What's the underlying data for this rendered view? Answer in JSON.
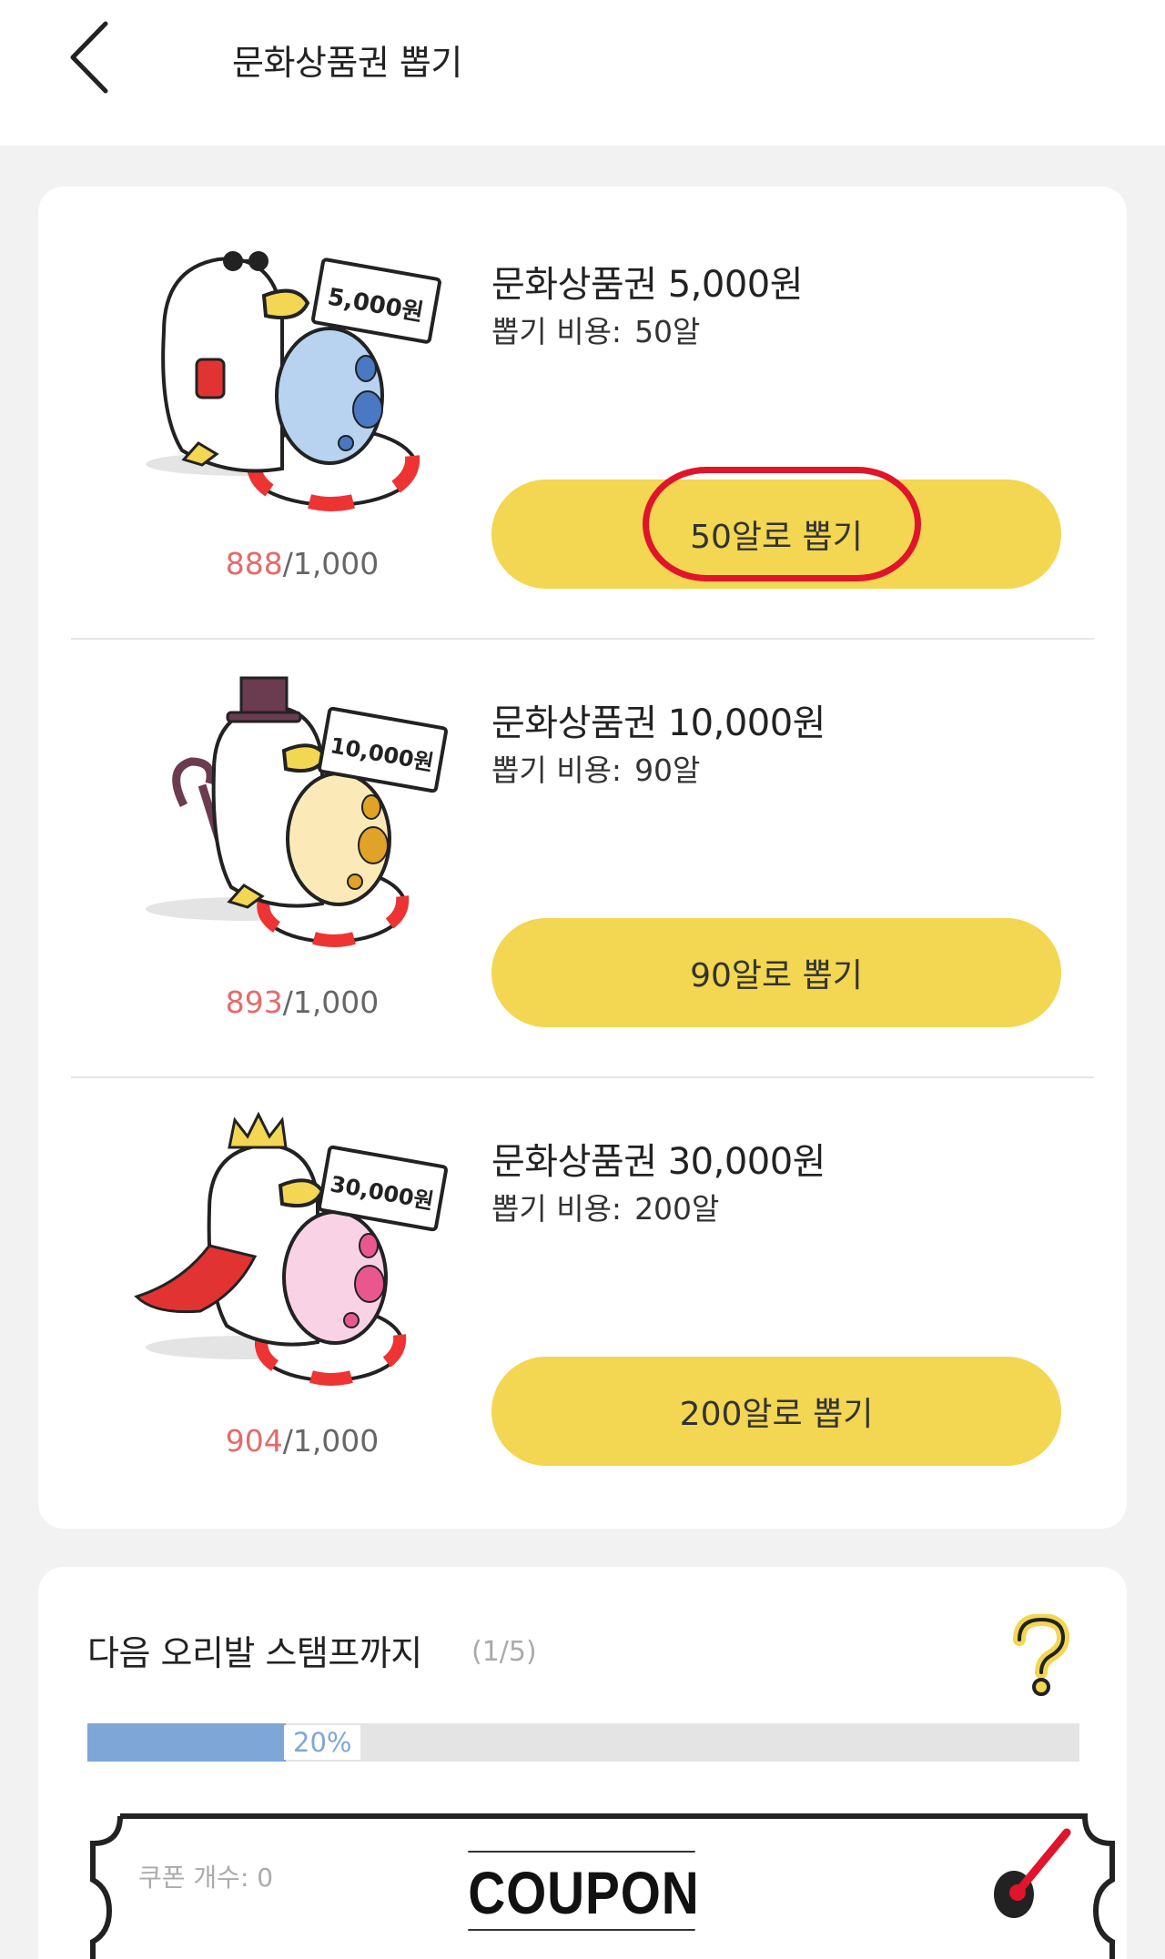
{
  "header": {
    "title": "문화상품권 뽑기"
  },
  "prizes": [
    {
      "name": "문화상품권 5,000원",
      "cost_label": "뽑기 비용:",
      "cost_value": "50알",
      "button_label": "50알로 뽑기",
      "remaining": "888",
      "total": "/1,000",
      "sign_text": "5,000원",
      "egg_color": "#b7d3ef",
      "egg_spot_color": "#4a78c2",
      "accessory": "sunglasses"
    },
    {
      "name": "문화상품권 10,000원",
      "cost_label": "뽑기 비용:",
      "cost_value": "90알",
      "button_label": "90알로 뽑기",
      "remaining": "893",
      "total": "/1,000",
      "sign_text": "10,000원",
      "egg_color": "#fbeab8",
      "egg_spot_color": "#e0a227",
      "accessory": "top-hat-and-cane"
    },
    {
      "name": "문화상품권 30,000원",
      "cost_label": "뽑기 비용:",
      "cost_value": "200알",
      "button_label": "200알로 뽑기",
      "remaining": "904",
      "total": "/1,000",
      "sign_text": "30,000원",
      "egg_color": "#f9d2e6",
      "egg_spot_color": "#e8588f",
      "accessory": "crown-and-cape"
    }
  ],
  "stamp": {
    "title": "다음 오리발 스탬프까지",
    "count": "(1/5)",
    "progress_percent": 20,
    "progress_label": "20%",
    "help_icon": "question-mark-icon"
  },
  "coupon": {
    "count_label": "쿠폰 개수: 0",
    "word": "COUPON"
  },
  "colors": {
    "button_yellow": "#f3d651",
    "remaining_red": "#e56a6a",
    "progress_blue": "#7ea7d8",
    "highlight_red": "#e0142a"
  }
}
